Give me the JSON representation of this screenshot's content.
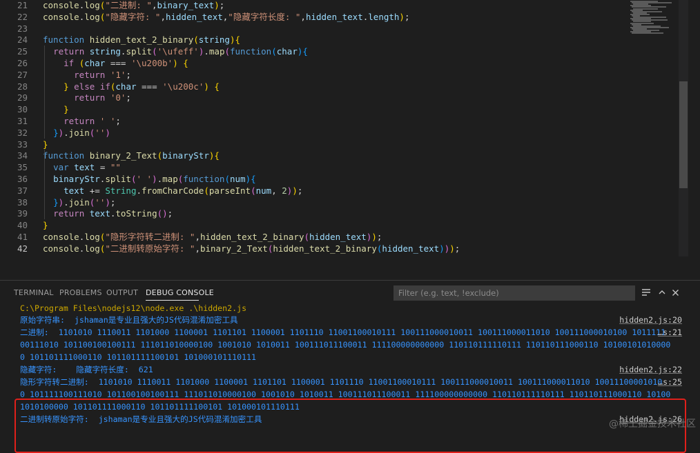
{
  "editor": {
    "lines": [
      {
        "n": "21",
        "t": [
          [
            "fn",
            "console"
          ],
          [
            "pun",
            "."
          ],
          [
            "fn",
            "log"
          ],
          [
            "br1",
            "("
          ],
          [
            "str",
            "\"二进制: \""
          ],
          [
            "pun",
            ","
          ],
          [
            "var",
            "binary_text"
          ],
          [
            "br1",
            ")"
          ],
          [
            "pun",
            ";"
          ]
        ]
      },
      {
        "n": "22",
        "t": [
          [
            "fn",
            "console"
          ],
          [
            "pun",
            "."
          ],
          [
            "fn",
            "log"
          ],
          [
            "br1",
            "("
          ],
          [
            "str",
            "\"隐藏字符: \""
          ],
          [
            "pun",
            ","
          ],
          [
            "var",
            "hidden_text"
          ],
          [
            "pun",
            ","
          ],
          [
            "str",
            "\"隐藏字符长度: \""
          ],
          [
            "pun",
            ","
          ],
          [
            "var",
            "hidden_text"
          ],
          [
            "pun",
            "."
          ],
          [
            "var",
            "length"
          ],
          [
            "br1",
            ")"
          ],
          [
            "pun",
            ";"
          ]
        ]
      },
      {
        "n": "23",
        "t": []
      },
      {
        "n": "24",
        "t": [
          [
            "kw",
            "function "
          ],
          [
            "fn",
            "hidden_text_2_binary"
          ],
          [
            "br1",
            "("
          ],
          [
            "var",
            "string"
          ],
          [
            "br1",
            ")"
          ],
          [
            "br1",
            "{"
          ]
        ]
      },
      {
        "n": "25",
        "t": [
          [
            "pun",
            "  "
          ],
          [
            "ctl",
            "return "
          ],
          [
            "var",
            "string"
          ],
          [
            "pun",
            "."
          ],
          [
            "fn",
            "split"
          ],
          [
            "br2",
            "("
          ],
          [
            "str",
            "'\\ufeff'"
          ],
          [
            "br2",
            ")"
          ],
          [
            "pun",
            "."
          ],
          [
            "fn",
            "map"
          ],
          [
            "br2",
            "("
          ],
          [
            "kw",
            "function"
          ],
          [
            "br3",
            "("
          ],
          [
            "var",
            "char"
          ],
          [
            "br3",
            ")"
          ],
          [
            "br3",
            "{"
          ]
        ]
      },
      {
        "n": "26",
        "t": [
          [
            "pun",
            "    "
          ],
          [
            "ctl",
            "if "
          ],
          [
            "br1",
            "("
          ],
          [
            "var",
            "char "
          ],
          [
            "pun",
            "=== "
          ],
          [
            "str",
            "'\\u200b'"
          ],
          [
            "br1",
            ")"
          ],
          [
            "pun",
            " "
          ],
          [
            "br1",
            "{"
          ]
        ]
      },
      {
        "n": "27",
        "t": [
          [
            "pun",
            "      "
          ],
          [
            "ctl",
            "return "
          ],
          [
            "str",
            "'1'"
          ],
          [
            "pun",
            ";"
          ]
        ]
      },
      {
        "n": "28",
        "t": [
          [
            "pun",
            "    "
          ],
          [
            "br1",
            "}"
          ],
          [
            "ctl",
            " else if"
          ],
          [
            "br1",
            "("
          ],
          [
            "var",
            "char "
          ],
          [
            "pun",
            "=== "
          ],
          [
            "str",
            "'\\u200c'"
          ],
          [
            "br1",
            ")"
          ],
          [
            "pun",
            " "
          ],
          [
            "br1",
            "{"
          ]
        ]
      },
      {
        "n": "29",
        "t": [
          [
            "pun",
            "      "
          ],
          [
            "ctl",
            "return "
          ],
          [
            "str",
            "'0'"
          ],
          [
            "pun",
            ";"
          ]
        ]
      },
      {
        "n": "30",
        "t": [
          [
            "pun",
            "    "
          ],
          [
            "br1",
            "}"
          ]
        ]
      },
      {
        "n": "31",
        "t": [
          [
            "pun",
            "    "
          ],
          [
            "ctl",
            "return "
          ],
          [
            "str",
            "' '"
          ],
          [
            "pun",
            ";"
          ]
        ]
      },
      {
        "n": "32",
        "t": [
          [
            "pun",
            "  "
          ],
          [
            "br3",
            "}"
          ],
          [
            "br2",
            ")"
          ],
          [
            "pun",
            "."
          ],
          [
            "fn",
            "join"
          ],
          [
            "br2",
            "("
          ],
          [
            "str",
            "''"
          ],
          [
            "br2",
            ")"
          ]
        ]
      },
      {
        "n": "33",
        "t": [
          [
            "br1",
            "}"
          ]
        ]
      },
      {
        "n": "34",
        "t": [
          [
            "kw",
            "function "
          ],
          [
            "fn",
            "binary_2_Text"
          ],
          [
            "br1",
            "("
          ],
          [
            "var",
            "binaryStr"
          ],
          [
            "br1",
            ")"
          ],
          [
            "br1",
            "{"
          ]
        ]
      },
      {
        "n": "35",
        "t": [
          [
            "pun",
            "  "
          ],
          [
            "kw",
            "var "
          ],
          [
            "var",
            "text "
          ],
          [
            "pun",
            "= "
          ],
          [
            "str",
            "\"\""
          ]
        ]
      },
      {
        "n": "36",
        "t": [
          [
            "pun",
            "  "
          ],
          [
            "var",
            "binaryStr"
          ],
          [
            "pun",
            "."
          ],
          [
            "fn",
            "split"
          ],
          [
            "br2",
            "("
          ],
          [
            "str",
            "' '"
          ],
          [
            "br2",
            ")"
          ],
          [
            "pun",
            "."
          ],
          [
            "fn",
            "map"
          ],
          [
            "br2",
            "("
          ],
          [
            "kw",
            "function"
          ],
          [
            "br3",
            "("
          ],
          [
            "var",
            "num"
          ],
          [
            "br3",
            ")"
          ],
          [
            "br3",
            "{"
          ]
        ]
      },
      {
        "n": "37",
        "t": [
          [
            "pun",
            "    "
          ],
          [
            "var",
            "text "
          ],
          [
            "pun",
            "+= "
          ],
          [
            "cls",
            "String"
          ],
          [
            "pun",
            "."
          ],
          [
            "fn",
            "fromCharCode"
          ],
          [
            "br1",
            "("
          ],
          [
            "fn",
            "parseInt"
          ],
          [
            "br2",
            "("
          ],
          [
            "var",
            "num"
          ],
          [
            "pun",
            ", "
          ],
          [
            "num",
            "2"
          ],
          [
            "br2",
            ")"
          ],
          [
            "br1",
            ")"
          ],
          [
            "pun",
            ";"
          ]
        ]
      },
      {
        "n": "38",
        "t": [
          [
            "pun",
            "  "
          ],
          [
            "br3",
            "}"
          ],
          [
            "br2",
            ")"
          ],
          [
            "pun",
            "."
          ],
          [
            "fn",
            "join"
          ],
          [
            "br2",
            "("
          ],
          [
            "str",
            "''"
          ],
          [
            "br2",
            ")"
          ],
          [
            "pun",
            ";"
          ]
        ]
      },
      {
        "n": "39",
        "t": [
          [
            "pun",
            "  "
          ],
          [
            "ctl",
            "return "
          ],
          [
            "var",
            "text"
          ],
          [
            "pun",
            "."
          ],
          [
            "fn",
            "toString"
          ],
          [
            "br2",
            "("
          ],
          [
            "br2",
            ")"
          ],
          [
            "pun",
            ";"
          ]
        ]
      },
      {
        "n": "40",
        "t": [
          [
            "br1",
            "}"
          ]
        ]
      },
      {
        "n": "41",
        "t": [
          [
            "fn",
            "console"
          ],
          [
            "pun",
            "."
          ],
          [
            "fn",
            "log"
          ],
          [
            "br1",
            "("
          ],
          [
            "str",
            "\"隐形字符转二进制: \""
          ],
          [
            "pun",
            ","
          ],
          [
            "fn",
            "hidden_text_2_binary"
          ],
          [
            "br2",
            "("
          ],
          [
            "var",
            "hidden_text"
          ],
          [
            "br2",
            ")"
          ],
          [
            "br1",
            ")"
          ],
          [
            "pun",
            ";"
          ]
        ]
      },
      {
        "n": "42",
        "t": [
          [
            "fn",
            "console"
          ],
          [
            "pun",
            "."
          ],
          [
            "fn",
            "log"
          ],
          [
            "br1",
            "("
          ],
          [
            "str",
            "\"二进制转原始字符: \""
          ],
          [
            "pun",
            ","
          ],
          [
            "fn",
            "binary_2_Text"
          ],
          [
            "br2",
            "("
          ],
          [
            "fn",
            "hidden_text_2_binary"
          ],
          [
            "br3",
            "("
          ],
          [
            "var",
            "hidden_text"
          ],
          [
            "br3",
            ")"
          ],
          [
            "br2",
            ")"
          ],
          [
            "br1",
            ")"
          ],
          [
            "pun",
            ";"
          ]
        ]
      }
    ]
  },
  "panel": {
    "tabs": {
      "terminal": "TERMINAL",
      "problems": "PROBLEMS",
      "output": "OUTPUT",
      "debug_console": "DEBUG CONSOLE"
    },
    "filter_placeholder": "Filter (e.g. text, !exclude)",
    "icons": {
      "wrap": "word-wrap-icon",
      "maximize": "chevron-up-icon",
      "close": "close-icon"
    }
  },
  "console": {
    "command": "C:\\Program Files\\nodejs12\\node.exe .\\hidden2.js",
    "lines": [
      "原始字符串:  jshaman是专业且强大的JS代码混淆加密工具",
      "二进制:  1101010 1110011 1101000 1100001 1101101 1100001 1101110 11001100010111 100111000010011 100111000011010 100111000010100 1011111",
      "00111010 101100100100111 111011010000100 1001010 1010011 100111011100011 111100000000000 110110111110111 110110111000110 10100101010000",
      "0 101101111000110 101101111100101 101000101110111",
      "隐藏字符:    隐藏字符长度:  621",
      "隐形字符转二进制:  1101010 1110011 1101000 1100001 1101101 1100001 1101110 11001100010111 100111000010011 100111000011010 10011100001010",
      "0 101111100111010 101100100100111 111011010000100 1001010 1010011 100111011100011 111100000000000 110110111110111 110110111000110 10100",
      "1010100000 101101111000110 101101111100101 101000101110111",
      "二进制转原始字符:  jshaman是专业且强大的JS代码混淆加密工具"
    ],
    "sources": [
      "hidden2.js:20",
      "…s:21",
      "hidden2.js:22",
      "…s:25",
      "hidden2.js:26"
    ]
  },
  "watermark": "@稀土掘金技术社区",
  "colors": {
    "highlight_box": "#e0201b",
    "output_text": "#3794ff",
    "command_text": "#cca700"
  }
}
